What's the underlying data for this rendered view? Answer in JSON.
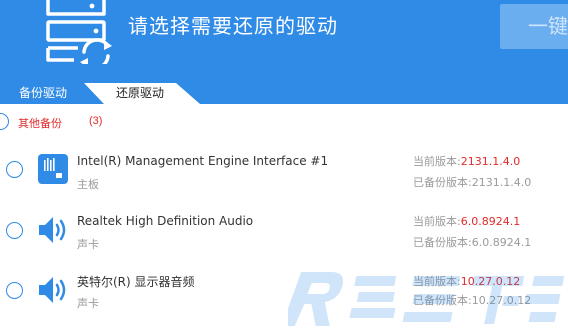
{
  "header": {
    "title": "请选择需要还原的驱动",
    "restore_button_label": "一键",
    "icon": "server-restore-icon"
  },
  "tabs": [
    {
      "label": "备份驱动",
      "active": false
    },
    {
      "label": "还原驱动",
      "active": true
    }
  ],
  "group": {
    "label": "其他备份",
    "count": "(3)"
  },
  "version_labels": {
    "current": "当前版本:",
    "backup": "已备份版本:"
  },
  "drivers": [
    {
      "name": "Intel(R) Management Engine Interface #1",
      "category": "主板",
      "icon": "motherboard-icon",
      "current_version": "2131.1.4.0",
      "backup_version": "2131.1.4.0"
    },
    {
      "name": "Realtek High Definition Audio",
      "category": "声卡",
      "icon": "speaker-icon",
      "current_version": "6.0.8924.1",
      "backup_version": "6.0.8924.1"
    },
    {
      "name": "英特尔(R) 显示器音频",
      "category": "声卡",
      "icon": "speaker-icon",
      "current_version": "10.27.0.12",
      "backup_version": "10.27.0.12"
    }
  ],
  "colors": {
    "header_bg": "#2f8be6",
    "accent_red": "#e02a2a",
    "icon_blue": "#2f8be6"
  }
}
